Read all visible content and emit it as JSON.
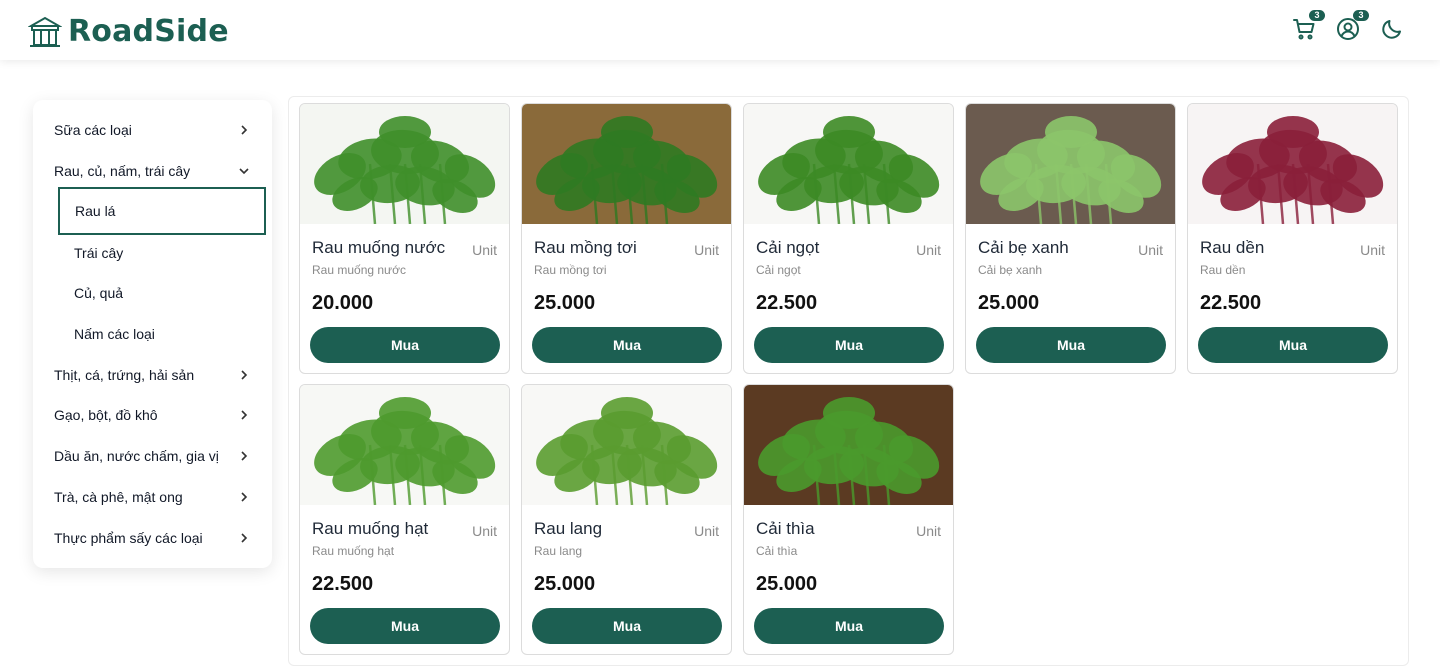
{
  "brand": {
    "name": "RoadSide"
  },
  "header": {
    "cart_count": "3",
    "account_count": "3"
  },
  "sidebar": {
    "categories": [
      {
        "label": "Sữa các loại",
        "expanded": false
      },
      {
        "label": "Rau, củ, nấm, trái cây",
        "expanded": true,
        "children": [
          {
            "label": "Rau lá",
            "active": true
          },
          {
            "label": "Trái cây"
          },
          {
            "label": "Củ, quả"
          },
          {
            "label": "Nấm các loại"
          }
        ]
      },
      {
        "label": "Thịt, cá, trứng, hải sản",
        "expanded": false
      },
      {
        "label": "Gạo, bột, đồ khô",
        "expanded": false
      },
      {
        "label": "Dầu ăn, nước chấm, gia vị",
        "expanded": false
      },
      {
        "label": "Trà, cà phê, mật ong",
        "expanded": false
      },
      {
        "label": "Thực phẩm sấy các loại",
        "expanded": false
      }
    ]
  },
  "products": [
    {
      "name": "Rau muống nước",
      "subtitle": "Rau muống nước",
      "unit": "Unit",
      "price": "20.000",
      "buy_label": "Mua",
      "bg": "#f4f6f2",
      "leaf": "#3f8f2a"
    },
    {
      "name": "Rau mồng tơi",
      "subtitle": "Rau mồng tơi",
      "unit": "Unit",
      "price": "25.000",
      "buy_label": "Mua",
      "bg": "#8a6a3a",
      "leaf": "#2f7a22"
    },
    {
      "name": "Cải ngọt",
      "subtitle": "Cải ngọt",
      "unit": "Unit",
      "price": "22.500",
      "buy_label": "Mua",
      "bg": "#f7f7f5",
      "leaf": "#3c8a25"
    },
    {
      "name": "Cải bẹ xanh",
      "subtitle": "Cải bẹ xanh",
      "unit": "Unit",
      "price": "25.000",
      "buy_label": "Mua",
      "bg": "#6b5b4f",
      "leaf": "#8cc56a"
    },
    {
      "name": "Rau dền",
      "subtitle": "Rau dền",
      "unit": "Unit",
      "price": "22.500",
      "buy_label": "Mua",
      "bg": "#f7f4f4",
      "leaf": "#8a1f3a"
    },
    {
      "name": "Rau muống hạt",
      "subtitle": "Rau muống hạt",
      "unit": "Unit",
      "price": "22.500",
      "buy_label": "Mua",
      "bg": "#f7f8f5",
      "leaf": "#4e9a2e"
    },
    {
      "name": "Rau lang",
      "subtitle": "Rau lang",
      "unit": "Unit",
      "price": "25.000",
      "buy_label": "Mua",
      "bg": "#f8f8f6",
      "leaf": "#5a9c30"
    },
    {
      "name": "Cải thìa",
      "subtitle": "Cải thìa",
      "unit": "Unit",
      "price": "25.000",
      "buy_label": "Mua",
      "bg": "#5b3a22",
      "leaf": "#4a9a2c"
    }
  ]
}
